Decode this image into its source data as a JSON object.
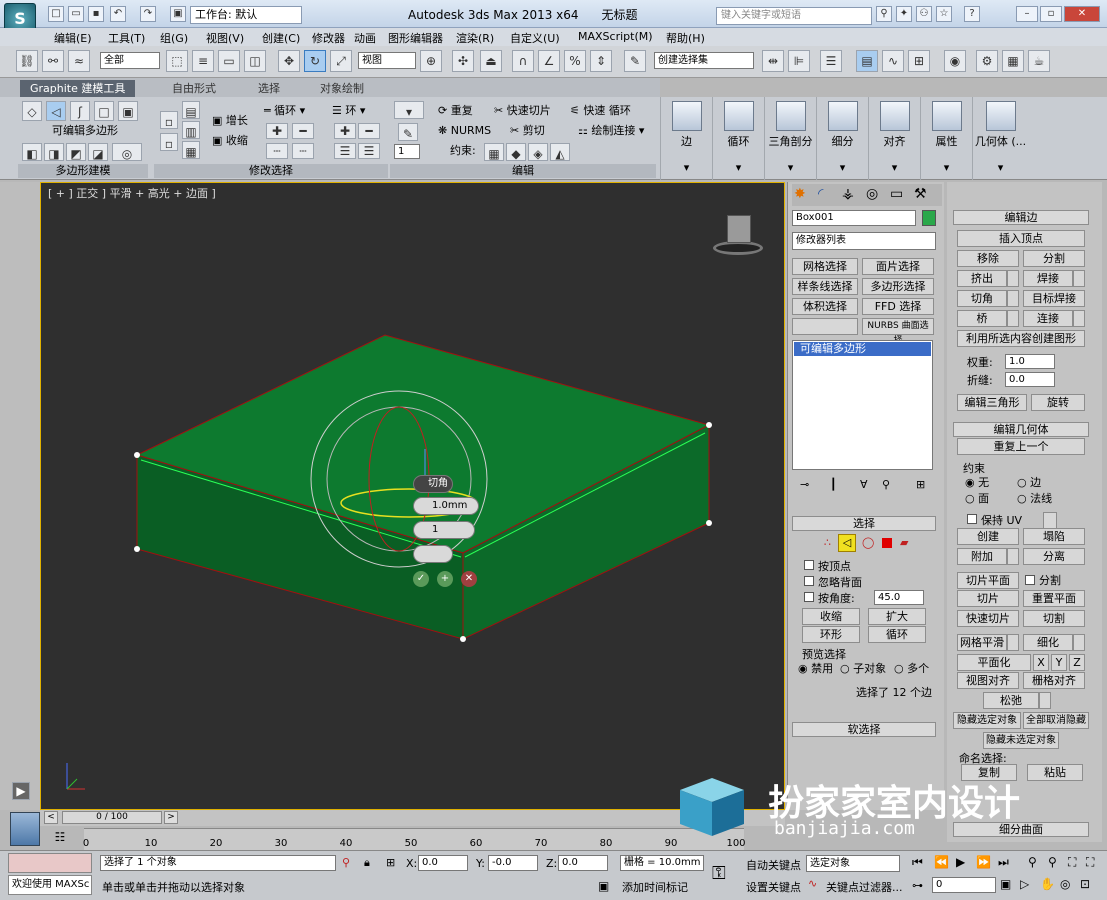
{
  "app": {
    "title": "Autodesk 3ds Max  2013 x64",
    "doc_title": "无标题",
    "workspace": "工作台: 默认",
    "search_placeholder": "键入关键字或短语"
  },
  "menu": [
    "编辑(E)",
    "工具(T)",
    "组(G)",
    "视图(V)",
    "创建(C)",
    "修改器",
    "动画",
    "图形编辑器",
    "渲染(R)",
    "自定义(U)",
    "MAXScript(M)",
    "帮助(H)"
  ],
  "toolbar": {
    "selection_filter": "全部",
    "ref_coord": "视图",
    "named_sel": "创建选择集"
  },
  "ribbon": {
    "tabs": [
      "Graphite 建模工具",
      "自由形式",
      "选择",
      "对象绘制"
    ],
    "poly_label": "可编辑多边形",
    "grow": "增长",
    "shrink": "收缩",
    "loop": "循环",
    "ring": "环",
    "repeat": "重复",
    "quickslice": "快速切片",
    "quickloop": "快速 循环",
    "nurms": "NURMS",
    "cut": "剪切",
    "drawconn": "绘制连接",
    "constraint": "约束:",
    "spin_value": "1",
    "groups": [
      "多边形建模",
      "修改选择",
      "编辑"
    ],
    "big": [
      "边",
      "循环",
      "三角剖分",
      "细分",
      "对齐",
      "属性",
      "几何体 (..."
    ]
  },
  "viewport": {
    "label": "[ + ] 正交 ] 平滑 + 高光 + 边面 ]",
    "caddy_title": "切角",
    "caddy_amount": "1.0mm",
    "caddy_segments": "1"
  },
  "cmd": {
    "object_name": "Box001",
    "object_color": "#2aa84a",
    "modifier_list": "修改器列表",
    "buttons": [
      "网格选择",
      "面片选择",
      "样条线选择",
      "多边形选择",
      "体积选择",
      "FFD 选择",
      "NURBS 曲面选择"
    ],
    "stack_item": "可编辑多边形",
    "selection": {
      "title": "选择",
      "by_vertex": "按顶点",
      "ignore_back": "忽略背面",
      "by_angle": "按角度:",
      "angle": "45.0",
      "shrink": "收缩",
      "grow": "扩大",
      "ring": "环形",
      "loop": "循环",
      "preview": "预览选择",
      "disabled": "禁用",
      "subobj": "子对象",
      "multi": "多个",
      "status": "选择了 12 个边"
    },
    "soft_sel": "软选择"
  },
  "edit_edges": {
    "title": "编辑边",
    "insert_vertex": "插入顶点",
    "remove": "移除",
    "split": "分割",
    "extrude": "挤出",
    "weld": "焊接",
    "chamfer": "切角",
    "target_weld": "目标焊接",
    "bridge": "桥",
    "connect": "连接",
    "create_shape": "利用所选内容创建图形",
    "weight_label": "权重:",
    "weight": "1.0",
    "crease_label": "折缝:",
    "crease": "0.0",
    "edit_tri": "编辑三角形",
    "turn": "旋转"
  },
  "edit_geom": {
    "title": "编辑几何体",
    "repeat_last": "重复上一个",
    "constraints": "约束",
    "c_none": "无",
    "c_edge": "边",
    "c_face": "面",
    "c_normal": "法线",
    "preserve_uv": "保持 UV",
    "create": "创建",
    "collapse": "塌陷",
    "attach": "附加",
    "detach": "分离",
    "slice_plane": "切片平面",
    "split": "分割",
    "slice": "切片",
    "reset_plane": "重置平面",
    "quickslice": "快速切片",
    "cut": "切割",
    "msmooth": "网格平滑",
    "tessellate": "细化",
    "planar": "平面化",
    "x": "X",
    "y": "Y",
    "z": "Z",
    "view_align": "视图对齐",
    "grid_align": "栅格对齐",
    "relax": "松弛",
    "hide_sel": "隐藏选定对象",
    "unhide_all": "全部取消隐藏",
    "hide_unsel": "隐藏未选定对象",
    "named_sel": "命名选择:",
    "copy": "复制",
    "paste": "粘贴",
    "subdiv": "细分曲面"
  },
  "timeline": {
    "frame": "0 / 100",
    "ticks": [
      "0",
      "10",
      "20",
      "30",
      "40",
      "50",
      "60",
      "70",
      "80",
      "90",
      "100"
    ]
  },
  "status": {
    "welcome": "欢迎使用 MAXSc",
    "selected": "选择了 1 个对象",
    "prompt": "单击或单击并拖动以选择对象",
    "x_label": "X:",
    "x": "0.0",
    "y_label": "Y:",
    "y": "-0.0",
    "z_label": "Z:",
    "z": "0.0",
    "grid": "栅格 = 10.0mm",
    "add_time_tag": "添加时间标记",
    "autokey": "自动关键点",
    "setkey": "设置关键点",
    "sel_obj": "选定对象",
    "key_filter": "关键点过滤器...",
    "frame": "0"
  },
  "watermark": {
    "text": "扮家家室内设计",
    "url": "banjiajia.com"
  }
}
